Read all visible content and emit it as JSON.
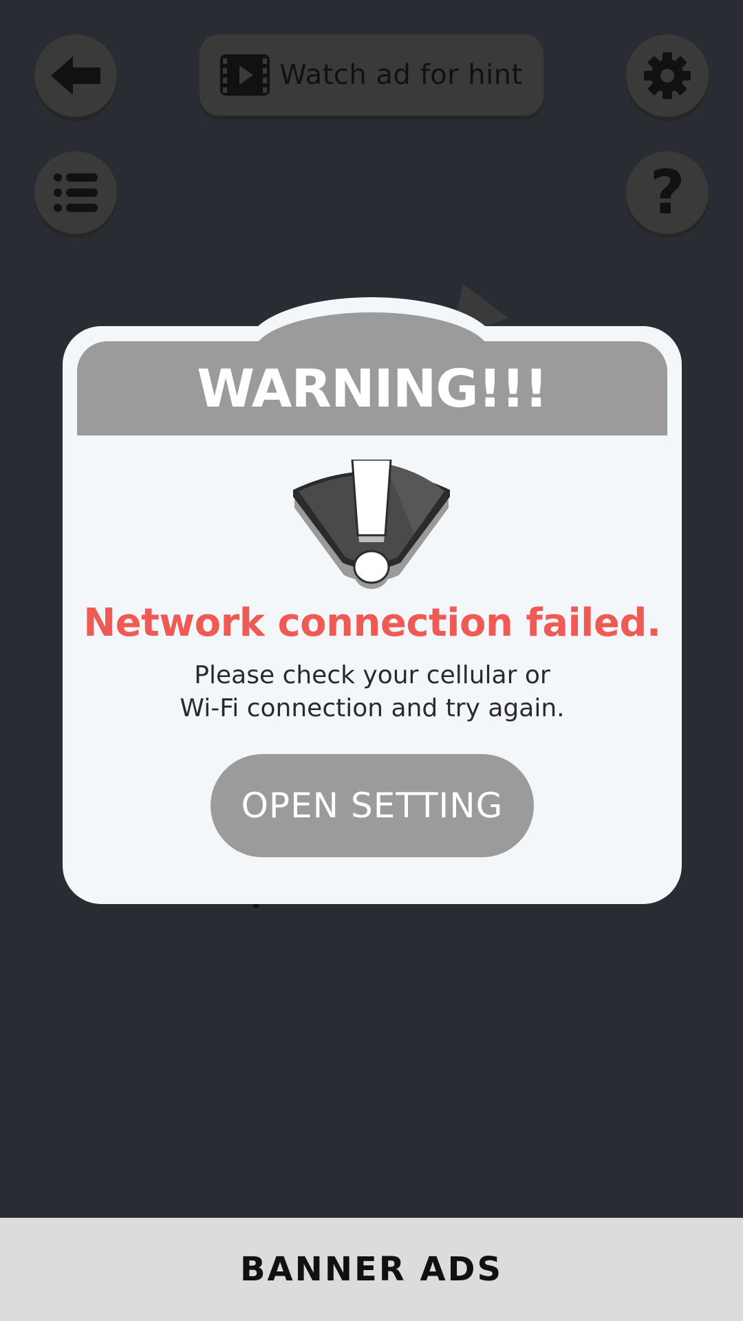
{
  "topbar": {
    "back_icon": "arrow-left-icon",
    "hint_label": "Watch ad for hint",
    "hint_icon": "film-play-icon",
    "settings_icon": "gear-icon",
    "list_icon": "list-icon",
    "help_glyph": "?"
  },
  "dialog": {
    "title": "WARNING!!!",
    "icon": "warning-exclamation-icon",
    "error": "Network connection failed.",
    "message_line1": "Please check your cellular or",
    "message_line2": "Wi-Fi connection and try again.",
    "button_label": "OPEN SETTING"
  },
  "banner": {
    "label": "BANNER ADS"
  },
  "colors": {
    "background": "#292c33",
    "dialog_bg": "#f3f7f9",
    "header_gray": "#9b9b9b",
    "error_red": "#f05a55",
    "banner_bg": "#dcdcdc"
  }
}
